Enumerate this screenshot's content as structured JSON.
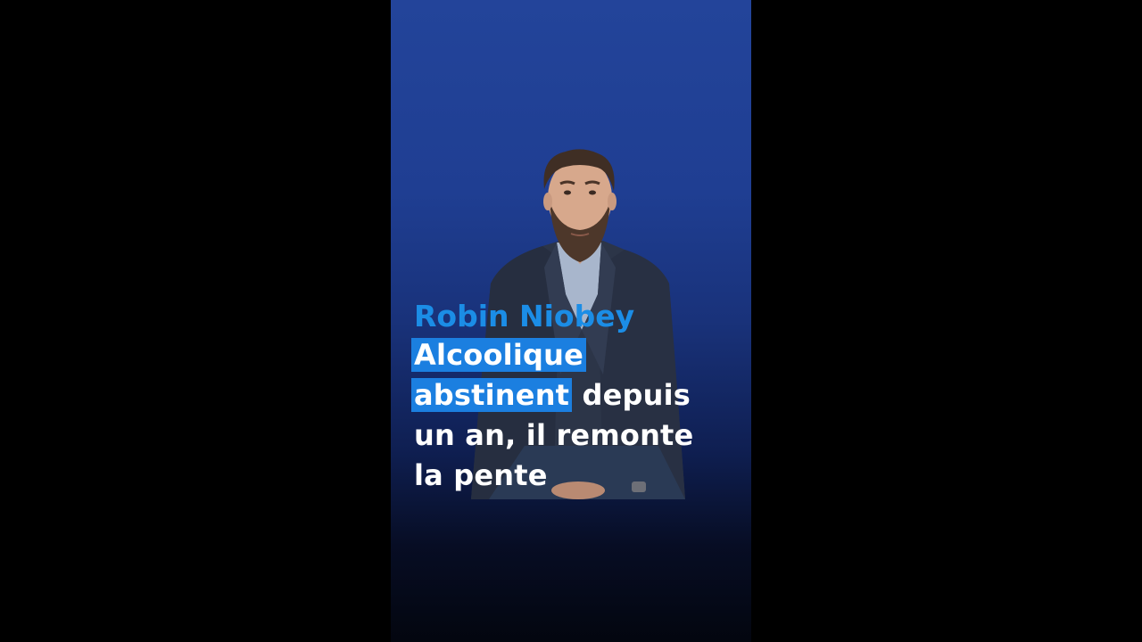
{
  "video": {
    "person_name": "Robin Niobey",
    "headline_highlight_1": "Alcoolique",
    "headline_highlight_2": "abstinent",
    "headline_rest_1": " depuis",
    "headline_line_3": "un an, il remonte",
    "headline_line_4": "la pente"
  },
  "colors": {
    "background_top": "#23449a",
    "background_bottom": "#03060f",
    "accent_blue": "#1b8de6",
    "highlight_blue": "#1b7fe0",
    "letterbox": "#000000"
  }
}
